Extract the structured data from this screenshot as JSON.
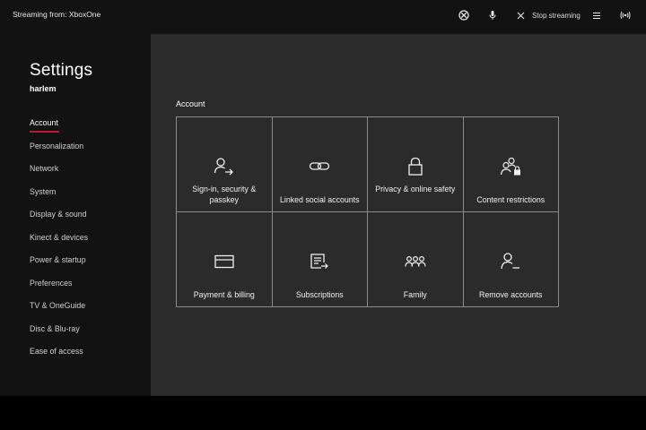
{
  "topbar": {
    "streaming_title": "Streaming from: XboxOne",
    "stop_label": "Stop streaming",
    "icons": [
      "xbox-icon",
      "microphone-icon",
      "close-icon",
      "menu-icon",
      "broadcast-icon"
    ]
  },
  "sidebar": {
    "title": "Settings",
    "user": "harlem",
    "items": [
      {
        "label": "Account",
        "active": true
      },
      {
        "label": "Personalization"
      },
      {
        "label": "Network"
      },
      {
        "label": "System"
      },
      {
        "label": "Display & sound"
      },
      {
        "label": "Kinect & devices"
      },
      {
        "label": "Power & startup"
      },
      {
        "label": "Preferences"
      },
      {
        "label": "TV & OneGuide"
      },
      {
        "label": "Disc & Blu-ray"
      },
      {
        "label": "Ease of access"
      }
    ]
  },
  "main": {
    "section_label": "Account",
    "tiles": [
      {
        "label": "Sign-in, security & passkey",
        "icon": "person-arrow-icon"
      },
      {
        "label": "Linked social accounts",
        "icon": "link-icon"
      },
      {
        "label": "Privacy & online safety",
        "icon": "lock-icon"
      },
      {
        "label": "Content restrictions",
        "icon": "people-lock-icon"
      },
      {
        "label": "Payment & billing",
        "icon": "credit-card-icon"
      },
      {
        "label": "Subscriptions",
        "icon": "subscriptions-icon"
      },
      {
        "label": "Family",
        "icon": "family-icon"
      },
      {
        "label": "Remove accounts",
        "icon": "person-remove-icon"
      }
    ]
  },
  "colors": {
    "accent": "#c0162f",
    "sidebar_bg": "#121212",
    "main_bg": "#2b2b2b",
    "tile_border": "#8a8a8a"
  }
}
